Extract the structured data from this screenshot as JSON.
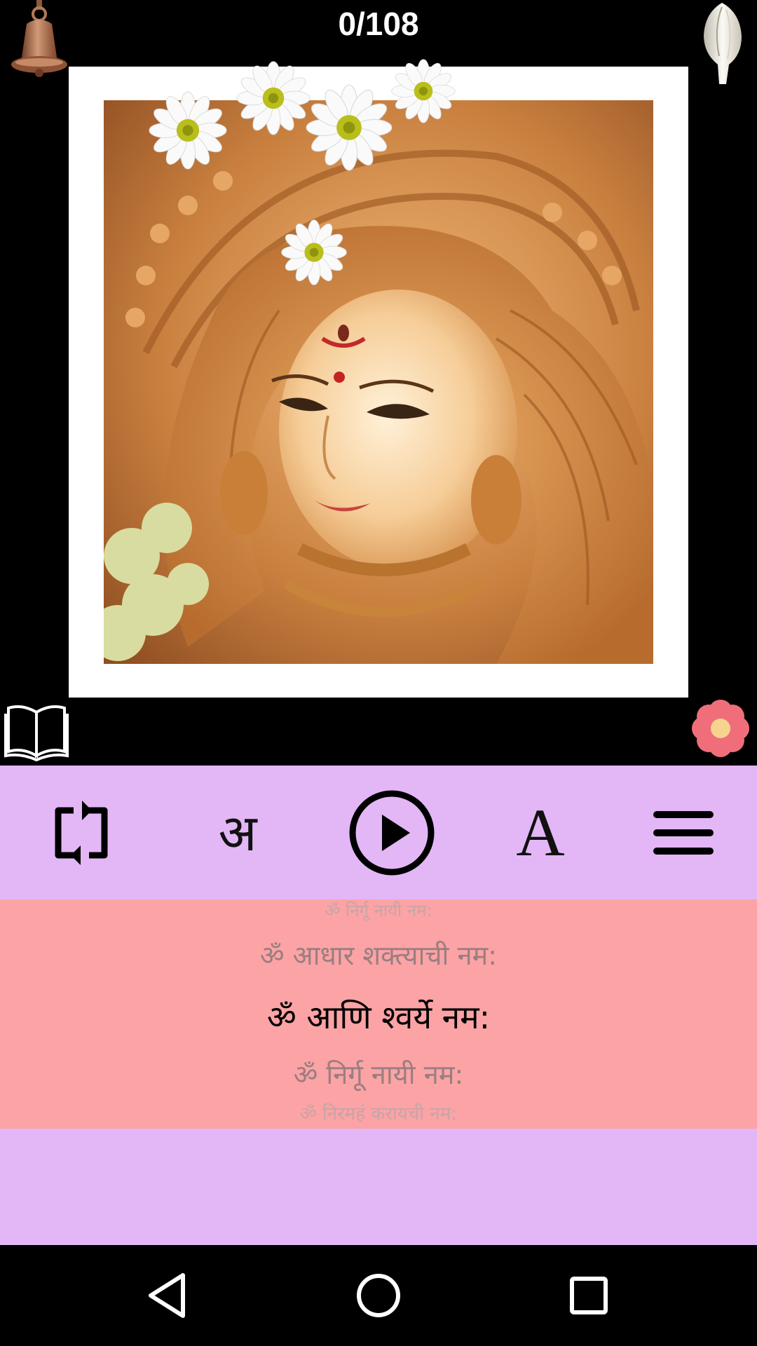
{
  "counter": "0/108",
  "toolbar": {
    "repeat_icon": "repeat-icon",
    "language_glyph": "अ",
    "play_icon": "play-icon",
    "font_glyph": "A",
    "menu_icon": "menu-icon"
  },
  "mantras": [
    "ॐ निर्गू नायी नम:",
    "ॐ आधार शक्त्याची नम:",
    "ॐ आणि श्वर्ये नम:",
    "ॐ निर्गू नायी नम:",
    "ॐ निरमहं करायची नम:"
  ],
  "colors": {
    "toolbar_bg": "#e3b7f6",
    "mantra_bg": "#fba3a5",
    "active_text": "#000000",
    "faded_text": "#9a7e80"
  },
  "icons": [
    "bell-icon",
    "conch-icon",
    "book-icon",
    "flower-icon",
    "back-icon",
    "home-icon",
    "recents-icon"
  ]
}
